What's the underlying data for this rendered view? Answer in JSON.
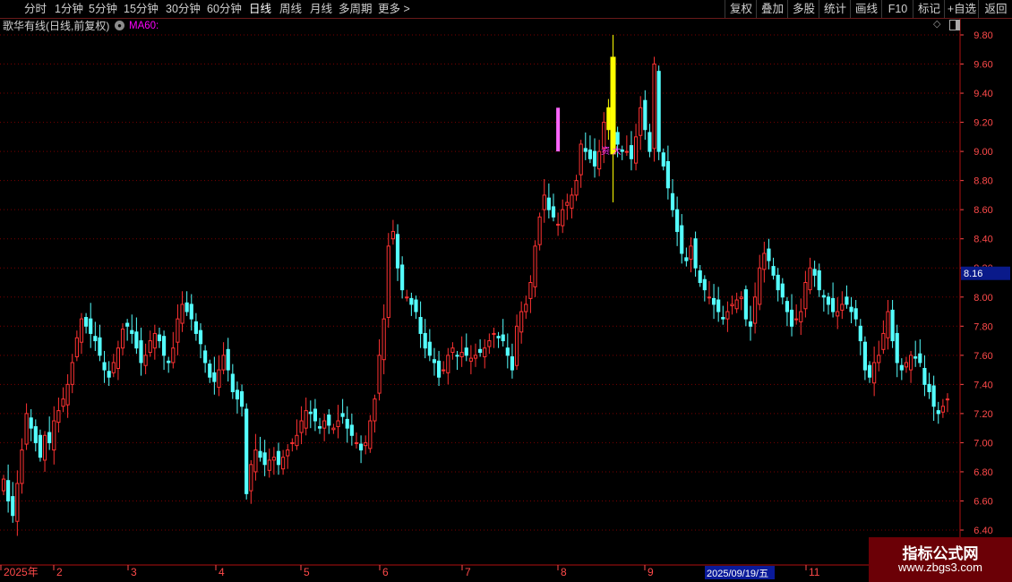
{
  "toolbar": {
    "periods": [
      "分时",
      "1分钟",
      "5分钟",
      "15分钟",
      "30分钟",
      "60分钟",
      "日线",
      "周线",
      "月线",
      "多周期",
      "更多"
    ],
    "active_period": "日线",
    "right_buttons": [
      "复权",
      "叠加",
      "多股",
      "统计",
      "画线",
      "F10",
      "标记",
      "+自选",
      "返回"
    ]
  },
  "info": {
    "title": "歌华有线(日线,前复权)",
    "ma_label": "MA60:",
    "ma_color": "#ff00ff"
  },
  "price_axis": {
    "ticks": [
      "9.80",
      "9.60",
      "9.40",
      "9.20",
      "9.00",
      "8.80",
      "8.60",
      "8.40",
      "8.20",
      "8.00",
      "7.80",
      "7.60",
      "7.40",
      "7.20",
      "7.00",
      "6.80",
      "6.60",
      "6.40"
    ],
    "current_price": "8.16"
  },
  "date_axis": {
    "labels": [
      "2025年",
      "2",
      "3",
      "4",
      "5",
      "6",
      "7",
      "8",
      "9",
      "2025/09/19/五",
      "11"
    ]
  },
  "annotation": {
    "text": "资 大"
  },
  "colors": {
    "up": "#ff3232",
    "down": "#54ffff",
    "highlight": "#ffff00",
    "special": "#ff66ff",
    "grid": "#7a0000",
    "axis_text": "#ff4a4a"
  },
  "watermark": {
    "title": "指标公式网",
    "url": "www.zbgs3.com"
  },
  "chart_data": {
    "type": "candlestick",
    "ylim": [
      6.4,
      9.8
    ],
    "closes": [
      6.75,
      6.6,
      6.5,
      6.72,
      6.95,
      7.2,
      7.1,
      7.0,
      6.9,
      7.05,
      7.0,
      7.15,
      7.22,
      7.3,
      7.4,
      7.55,
      7.72,
      7.85,
      7.8,
      7.75,
      7.7,
      7.6,
      7.5,
      7.45,
      7.55,
      7.65,
      7.78,
      7.8,
      7.75,
      7.65,
      7.55,
      7.6,
      7.7,
      7.75,
      7.7,
      7.6,
      7.55,
      7.65,
      7.85,
      7.95,
      7.9,
      7.85,
      7.75,
      7.68,
      7.55,
      7.45,
      7.42,
      7.5,
      7.6,
      7.5,
      7.35,
      7.3,
      7.25,
      6.65,
      6.85,
      6.95,
      6.9,
      6.85,
      6.88,
      6.9,
      6.85,
      6.9,
      6.95,
      7.0,
      7.05,
      7.15,
      7.22,
      7.2,
      7.15,
      7.1,
      7.15,
      7.12,
      7.1,
      7.15,
      7.18,
      7.1,
      7.05,
      7.0,
      6.95,
      7.0,
      7.15,
      7.3,
      7.6,
      7.85,
      8.35,
      8.45,
      8.2,
      8.05,
      8.0,
      7.95,
      7.9,
      7.75,
      7.65,
      7.6,
      7.55,
      7.45,
      7.5,
      7.6,
      7.65,
      7.6,
      7.62,
      7.6,
      7.58,
      7.6,
      7.62,
      7.65,
      7.7,
      7.75,
      7.72,
      7.7,
      7.6,
      7.5,
      7.8,
      7.9,
      7.95,
      8.1,
      8.35,
      8.55,
      8.7,
      8.6,
      8.55,
      8.5,
      8.6,
      8.65,
      8.7,
      8.8,
      9.05,
      9.0,
      8.95,
      8.9,
      9.0,
      9.2,
      9.3,
      9.1,
      9.05,
      9.0,
      9.0,
      8.95,
      9.1,
      9.3,
      9.15,
      9.0,
      9.6,
      9.0,
      8.9,
      8.75,
      8.6,
      8.45,
      8.3,
      8.25,
      8.35,
      8.2,
      8.1,
      8.05,
      8.0,
      7.95,
      7.9,
      7.85,
      7.9,
      7.95,
      7.98,
      8.0,
      7.85,
      7.8,
      8.0,
      8.2,
      8.3,
      8.25,
      8.15,
      8.05,
      8.0,
      7.9,
      7.8,
      7.85,
      7.9,
      8.1,
      8.2,
      8.15,
      8.05,
      8.0,
      7.95,
      7.9,
      7.9,
      7.95,
      7.95,
      7.9,
      7.85,
      7.7,
      7.5,
      7.45,
      7.55,
      7.6,
      7.75,
      7.9,
      7.7,
      7.55,
      7.5,
      7.55,
      7.6,
      7.58,
      7.55,
      7.4,
      7.35,
      7.25,
      7.2,
      7.25,
      7.3
    ]
  }
}
